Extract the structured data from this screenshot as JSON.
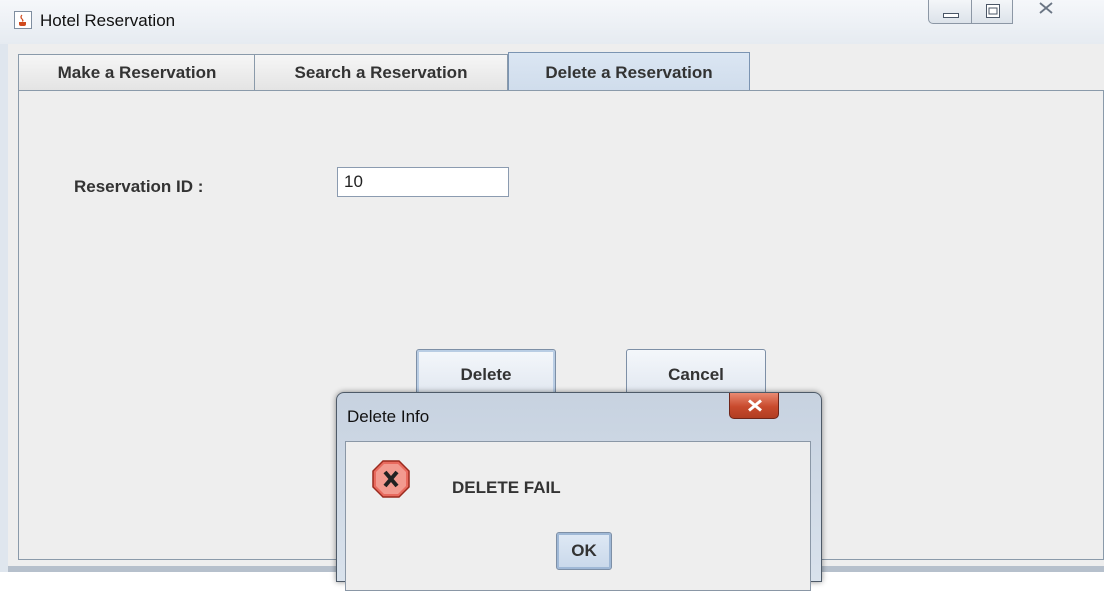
{
  "window": {
    "title": "Hotel Reservation",
    "app_icon": "java-cup-icon",
    "controls": [
      "minimize-icon",
      "maximize-icon",
      "close-icon"
    ]
  },
  "tabs": [
    {
      "label": "Make a Reservation",
      "selected": false
    },
    {
      "label": "Search a Reservation",
      "selected": false
    },
    {
      "label": "Delete a Reservation",
      "selected": true
    }
  ],
  "form": {
    "reservation_id_label": "Reservation ID :",
    "reservation_id_value": "10",
    "delete_label": "Delete",
    "cancel_label": "Cancel"
  },
  "dialog": {
    "title": "Delete Info",
    "message": "DELETE FAIL",
    "icon": "error-icon",
    "ok_label": "OK"
  },
  "colors": {
    "error_red": "#d83a2a",
    "close_button": "#c84a2d",
    "selected_tab": "#cfdceb"
  }
}
